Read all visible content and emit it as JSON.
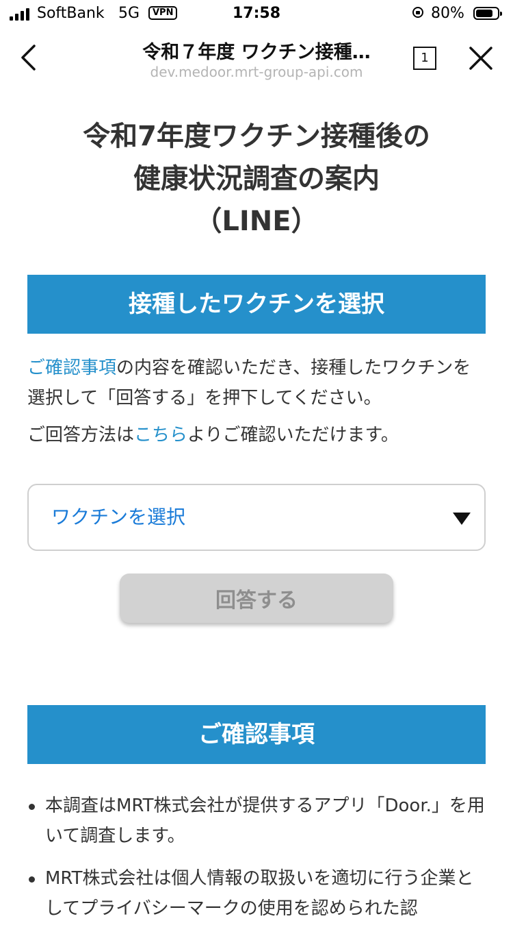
{
  "status_bar": {
    "carrier": "SoftBank",
    "network": "5G",
    "vpn": "VPN",
    "time": "17:58",
    "battery_percent": "80%",
    "battery_level": 0.8
  },
  "browser": {
    "title": "令和７年度 ワクチン接種…",
    "url": "dev.medoor.mrt-group-api.com",
    "tab_count": "1"
  },
  "page": {
    "title_lines": [
      "令和7年度ワクチン接種後の",
      "健康状況調査の案内",
      "（LINE）"
    ],
    "section_select_heading": "接種したワクチンを選択",
    "intro": {
      "link_text": "ご確認事項",
      "text": "の内容を確認いただき、接種したワクチンを選択して「回答する」を押下してください。"
    },
    "intro2": {
      "before": "ご回答方法は",
      "link_text": "こちら",
      "after": "よりご確認いただけます。"
    },
    "select": {
      "label": "ワクチンを選択"
    },
    "submit_label": "回答する",
    "confirm_heading": "ご確認事項",
    "notes": [
      "本調査はMRT株式会社が提供するアプリ「Door.」を用いて調査します。",
      "MRT株式会社は個人情報の取扱いを適切に行う企業としてプライバシーマークの使用を認められた認"
    ]
  },
  "colors": {
    "accent": "#2590cb",
    "select_text": "#1a7bd8",
    "disabled_button": "#d2d2d2"
  }
}
